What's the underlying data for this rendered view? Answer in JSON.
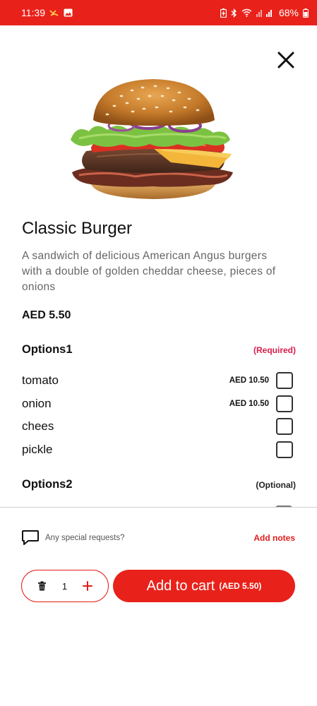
{
  "status_bar": {
    "time": "11:39",
    "battery": "68%",
    "icons": [
      "missed-call-icon",
      "gallery-icon",
      "battery-saver-icon",
      "bluetooth-icon",
      "wifi-icon",
      "signal-icon",
      "battery-icon"
    ]
  },
  "product": {
    "title": "Classic Burger",
    "description": "A sandwich of delicious American Angus burgers with a double of golden cheddar cheese, pieces of onions",
    "price": "AED 5.50"
  },
  "options1": {
    "title": "Options1",
    "tag": "(Required)",
    "items": [
      {
        "name": "tomato",
        "price": "AED 10.50",
        "checked": false
      },
      {
        "name": "onion",
        "price": "AED 10.50",
        "checked": false
      },
      {
        "name": "chees",
        "price": "",
        "checked": false
      },
      {
        "name": "pickle",
        "price": "",
        "checked": false
      }
    ]
  },
  "options2": {
    "title": "Options2",
    "tag": "(Optional)"
  },
  "notes": {
    "placeholder": "Any special requests?",
    "action": "Add notes"
  },
  "cart": {
    "quantity": "1",
    "add_label": "Add to cart",
    "add_price": "(AED 5.50)"
  },
  "colors": {
    "accent": "#e8221b",
    "required": "#d81b4a"
  }
}
